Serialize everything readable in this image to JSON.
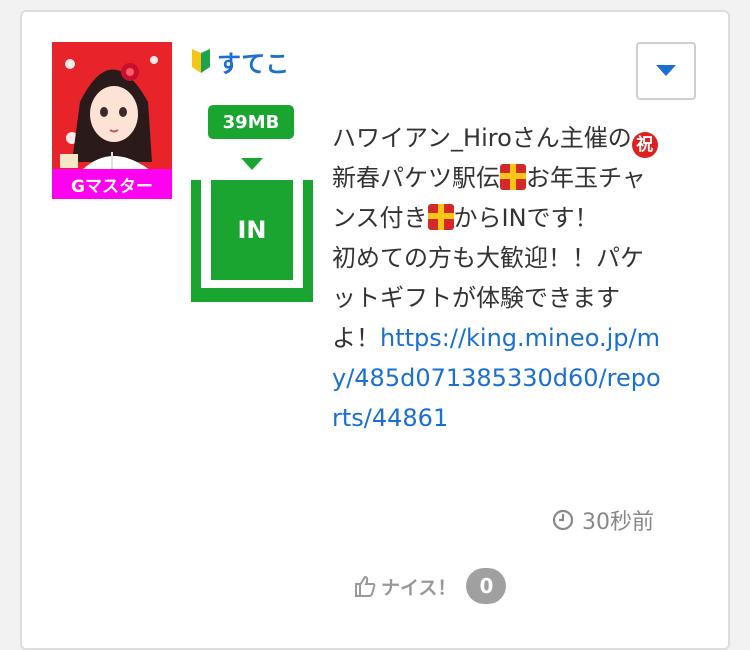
{
  "post": {
    "rank_badge": "Gマスター",
    "username": "すてこ",
    "data_size": "39MB",
    "in_label": "IN",
    "message_part1": "ハワイアン_Hiroさん主催の",
    "emoji_iwai": "祝",
    "message_part2": "新春パケツ駅伝",
    "message_part3": "お年玉チャンス付き",
    "message_part4": "からINです！",
    "message_part5": "初めての方も大歓迎！！パケットギフトが体験できますよ！",
    "link": "https://king.mineo.jp/my/485d071385330d60/reports/44861",
    "time": "30秒前",
    "nice_label": "ナイス！",
    "nice_count": "0"
  },
  "icons": {
    "beginner": "beginner-mark-icon",
    "dropdown": "caret-down-icon",
    "clock": "clock-icon",
    "thumb": "thumbs-up-icon",
    "gift": "gift-icon"
  },
  "colors": {
    "accent_green": "#19a530",
    "link_blue": "#1a6fd1",
    "rank_magenta": "#ff00f0",
    "avatar_red": "#e8232a"
  }
}
